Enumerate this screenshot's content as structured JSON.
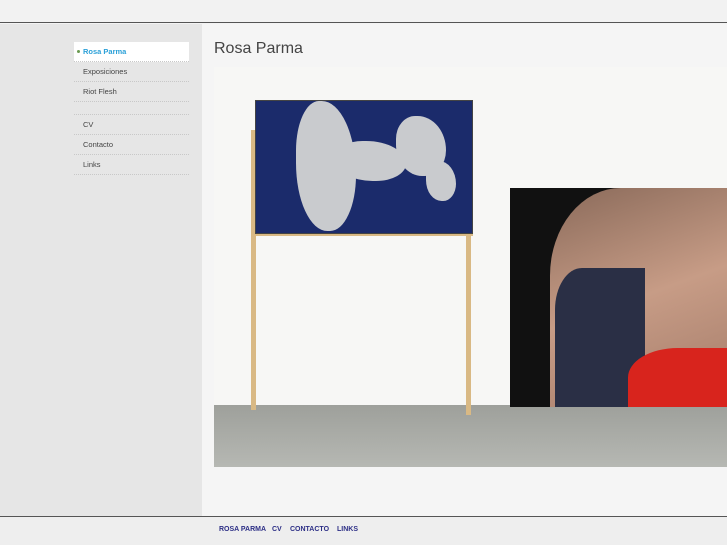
{
  "nav": {
    "items": [
      {
        "label": "Rosa Parma",
        "active": true
      },
      {
        "label": "Exposiciones"
      },
      {
        "label": "Riot Flesh"
      },
      {
        "label": "CV"
      },
      {
        "label": "Contacto"
      },
      {
        "label": "Links"
      }
    ]
  },
  "page": {
    "title": "Rosa Parma"
  },
  "footer": {
    "links": [
      "ROSA PARMA",
      "CV",
      "CONTACTO",
      "LINKS"
    ]
  }
}
